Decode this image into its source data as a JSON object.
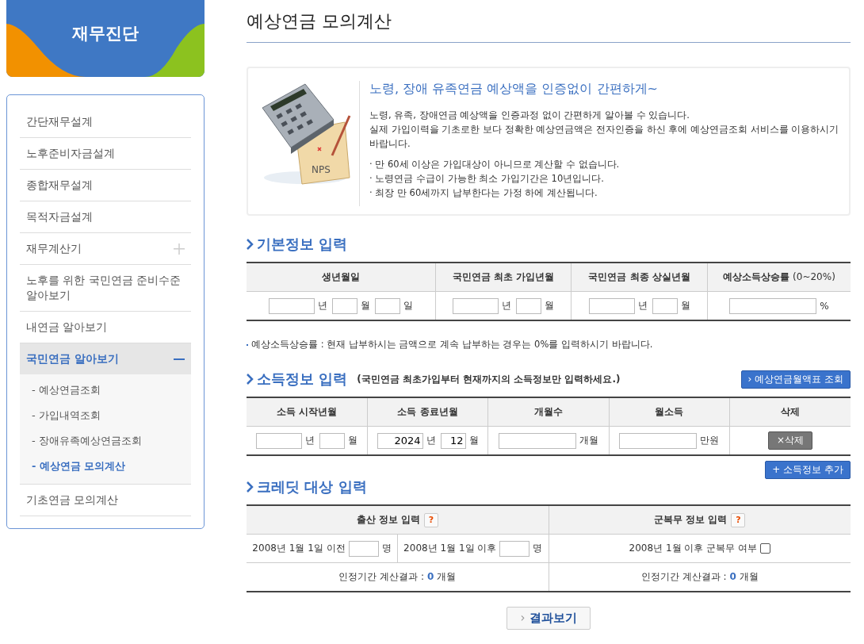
{
  "sidebar": {
    "banner_title": "재무진단",
    "items": [
      {
        "label": "간단재무설계",
        "kind": "plain",
        "selected": false
      },
      {
        "label": "노후준비자금설계",
        "kind": "plain",
        "selected": false
      },
      {
        "label": "종합재무설계",
        "kind": "plain",
        "selected": false
      },
      {
        "label": "목적자금설계",
        "kind": "plain",
        "selected": false
      },
      {
        "label": "재무계산기",
        "kind": "expandable",
        "expanded": false,
        "selected": false
      },
      {
        "label": "노후를 위한 국민연금 준비수준 알아보기",
        "kind": "plain",
        "selected": false
      },
      {
        "label": "내연금 알아보기",
        "kind": "plain",
        "selected": false
      },
      {
        "label": "국민연금 알아보기",
        "kind": "expandable",
        "expanded": true,
        "selected": true,
        "children": [
          {
            "label": "- 예상연금조회",
            "selected": false
          },
          {
            "label": "- 가입내역조회",
            "selected": false
          },
          {
            "label": "- 장애유족예상연금조회",
            "selected": false
          },
          {
            "label": "- 예상연금 모의계산",
            "selected": true
          }
        ]
      },
      {
        "label": "기초연금 모의계산",
        "kind": "plain",
        "selected": false
      }
    ]
  },
  "page_title": "예상연금 모의계산",
  "intro": {
    "illustration_label": "NPS",
    "heading": "노령, 장애 유족연금 예상액을 인증없이 간편하게~",
    "paragraphs": [
      "노령, 유족, 장애연금 예상액을 인증과정 없이 간편하게 알아볼 수 있습니다.",
      "실제 가입이력을 기초로한 보다 정확한 예상연금액은 전자인증을 하신 후에 예상연금조회 서비스를 이용하시기 바랍니다."
    ],
    "notes": [
      "· 만 60세 이상은 가입대상이 아니므로 계산할 수 없습니다.",
      "· 노령연금 수급이 가능한 최소 가입기간은 10년입니다.",
      "· 최장 만 60세까지 납부한다는 가정 하에 계산됩니다."
    ]
  },
  "basic_info": {
    "title": "기본정보 입력",
    "columns": [
      {
        "label": "생년월일"
      },
      {
        "label": "국민연금 최초 가입년월"
      },
      {
        "label": "국민연금 최종 상실년월"
      },
      {
        "label": "예상소득상승률",
        "hint": "(0~20%)"
      }
    ],
    "cells": [
      [
        {
          "kind": "year",
          "unit": "년"
        },
        {
          "kind": "short",
          "unit": "월"
        },
        {
          "kind": "short",
          "unit": "일"
        }
      ],
      [
        {
          "kind": "year",
          "unit": "년"
        },
        {
          "kind": "short",
          "unit": "월"
        }
      ],
      [
        {
          "kind": "year",
          "unit": "년"
        },
        {
          "kind": "short",
          "unit": "월"
        }
      ],
      [
        {
          "kind": "rate",
          "unit": "%"
        }
      ]
    ],
    "note": "예상소득상승률 : 현재 납부하시는 금액으로 계속 납부하는 경우는 0%를 입력하시기 바랍니다."
  },
  "income_info": {
    "title": "소득정보 입력",
    "subtitle": "(국민연금 최초가입부터 현재까지의 소득정보만 입력하세요.)",
    "lookup_button": "› 예상연금월액표 조회",
    "columns": [
      "소득 시작년월",
      "소득 종료년월",
      "개월수",
      "월소득",
      "삭제"
    ],
    "rows": [
      {
        "cells": [
          [
            {
              "kind": "year",
              "unit": "년"
            },
            {
              "kind": "short",
              "unit": "월"
            }
          ],
          [
            {
              "kind": "year",
              "unit": "년",
              "value": "2024"
            },
            {
              "kind": "short",
              "unit": "월",
              "value": "12"
            }
          ],
          [
            {
              "kind": "amount",
              "unit": "개월"
            }
          ],
          [
            {
              "kind": "amount",
              "unit": "만원"
            }
          ]
        ],
        "delete_button": "×삭제"
      }
    ],
    "add_button": "+ 소득정보 추가"
  },
  "credit": {
    "title": "크레딧 대상 입력",
    "birth": {
      "header": "출산 정보 입력",
      "help": "?",
      "fields": [
        {
          "label": "2008년 1월 1일 이전",
          "unit": "명"
        },
        {
          "label": "2008년 1월 1일 이후",
          "unit": "명"
        }
      ],
      "result": {
        "label": "인정기간 계산결과 :",
        "value": "0",
        "unit": "개월"
      }
    },
    "military": {
      "header": "군복무 정보 입력",
      "help": "?",
      "checkbox": {
        "label": "2008년 1월 이후 군복무 여부",
        "checked": false
      },
      "result": {
        "label": "인정기간 계산결과 :",
        "value": "0",
        "unit": "개월"
      }
    }
  },
  "result_button": {
    "icon": "›",
    "label": "결과보기"
  }
}
